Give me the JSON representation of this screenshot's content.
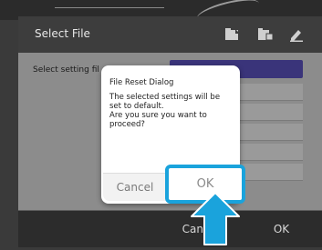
{
  "window": {
    "title": "Select File"
  },
  "body": {
    "select_label": "Select setting fil"
  },
  "bottom_bar": {
    "cancel_label": "Cancel",
    "ok_label": "OK"
  },
  "dialog": {
    "title": "File Reset Dialog",
    "message_lines": [
      "The selected settings will be",
      "set to default.",
      "Are you sure you want to",
      "proceed?"
    ],
    "cancel_label": "Cancel",
    "ok_label": "OK"
  },
  "icons": {
    "header": [
      "file-load-icon",
      "file-save-icon",
      "edit-icon"
    ],
    "pointer": "arrow-up-icon"
  },
  "colors": {
    "highlight": "#1aa3dc",
    "accent_field": "#3a347a"
  }
}
